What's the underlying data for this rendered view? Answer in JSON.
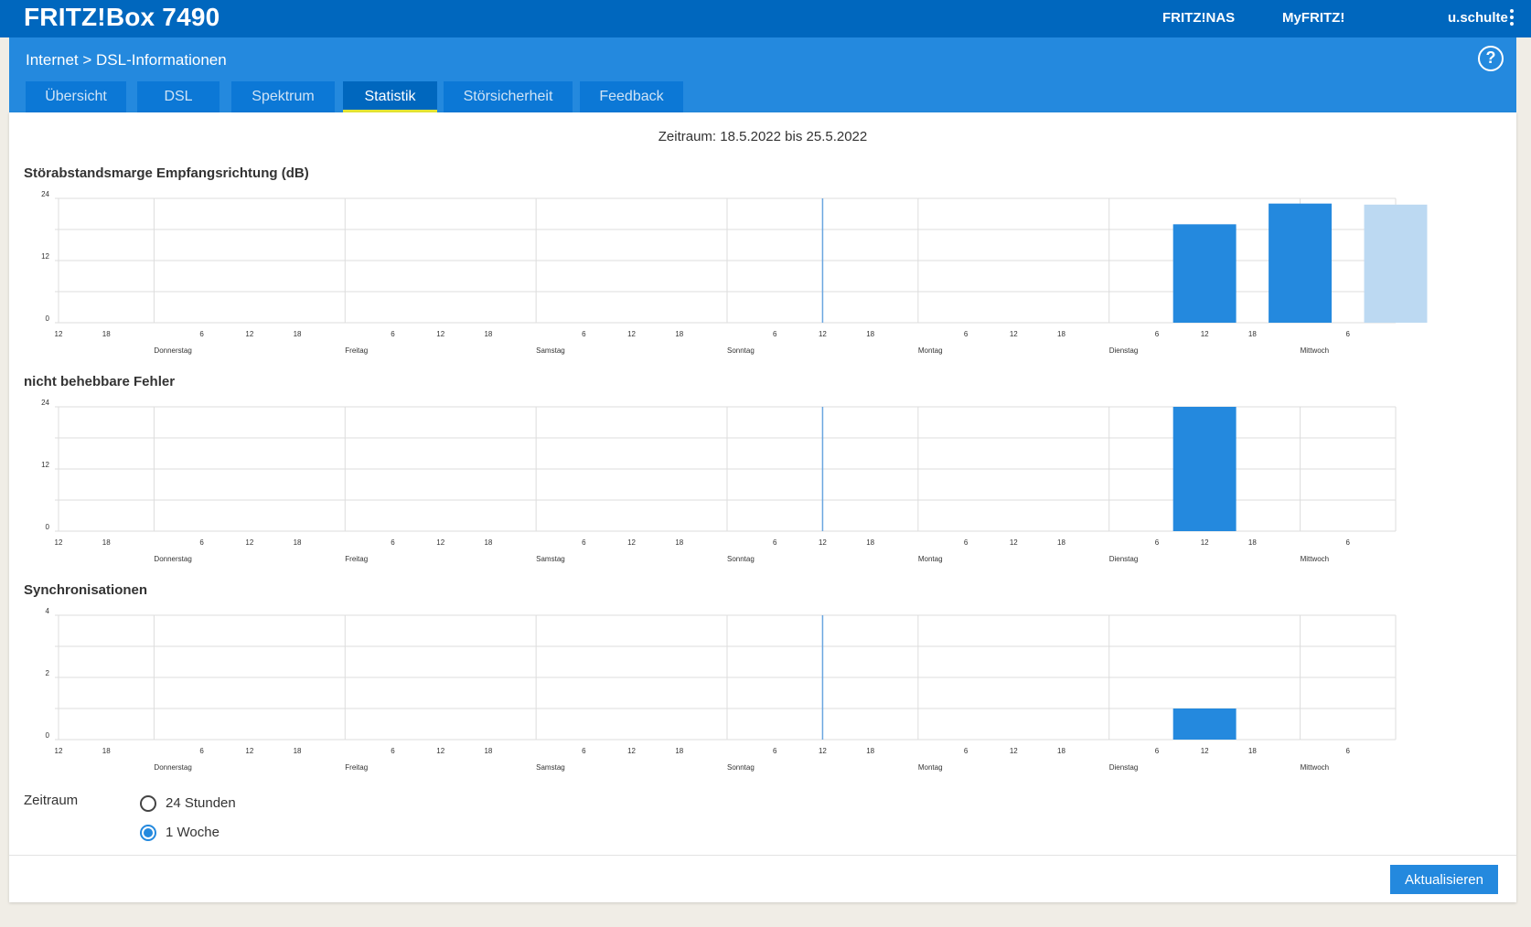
{
  "header": {
    "brand": "FRITZ!Box 7490",
    "links": [
      "FRITZ!NAS",
      "MyFRITZ!"
    ],
    "user": "u.schulte",
    "menu_icon": "kebab-menu-icon"
  },
  "subheader": {
    "breadcrumb": "Internet > DSL-Informationen",
    "help_icon": "help-icon",
    "help_symbol": "?"
  },
  "tabs": [
    {
      "label": "Übersicht",
      "active": false
    },
    {
      "label": "DSL",
      "active": false
    },
    {
      "label": "Spektrum",
      "active": false
    },
    {
      "label": "Statistik",
      "active": true
    },
    {
      "label": "Störsicherheit",
      "active": false
    },
    {
      "label": "Feedback",
      "active": false
    }
  ],
  "period_text": "Zeitraum: 18.5.2022 bis 25.5.2022",
  "colors": {
    "topbar": "#0067be",
    "subheader": "#2489de",
    "bar": "#2489de",
    "bar_light": "#bcd9f2",
    "marker": "#6aa6e0",
    "grid": "#dddddd"
  },
  "chart_data": [
    {
      "type": "bar",
      "title": "Störabstandsmarge Empfangsrichtung (dB)",
      "x_unit": "hour",
      "x_range": [
        12,
        180
      ],
      "bar_width_hours": 12,
      "ylim": [
        0,
        24
      ],
      "y_ticks": [
        0,
        12,
        24
      ],
      "grid": true,
      "day_labels": [
        "Donnerstag",
        "Freitag",
        "Samstag",
        "Sonntag",
        "Montag",
        "Dienstag",
        "Mittwoch"
      ],
      "hour_tick_labels": [
        "12",
        "18",
        "6",
        "12",
        "18",
        "6",
        "12",
        "18",
        "6",
        "12",
        "18",
        "6",
        "12",
        "18",
        "6",
        "12",
        "18",
        "6",
        "12",
        "18",
        "6"
      ],
      "current_marker_x": 108,
      "bars": [
        {
          "x": 150,
          "value": 19,
          "light": false
        },
        {
          "x": 162,
          "value": 23,
          "light": false
        },
        {
          "x": 174,
          "value": 22.8,
          "light": true
        }
      ]
    },
    {
      "type": "bar",
      "title": "nicht behebbare Fehler",
      "x_unit": "hour",
      "x_range": [
        12,
        180
      ],
      "bar_width_hours": 12,
      "ylim": [
        0,
        24
      ],
      "y_ticks": [
        0,
        12,
        24
      ],
      "grid": true,
      "day_labels": [
        "Donnerstag",
        "Freitag",
        "Samstag",
        "Sonntag",
        "Montag",
        "Dienstag",
        "Mittwoch"
      ],
      "hour_tick_labels": [
        "12",
        "18",
        "6",
        "12",
        "18",
        "6",
        "12",
        "18",
        "6",
        "12",
        "18",
        "6",
        "12",
        "18",
        "6",
        "12",
        "18",
        "6",
        "12",
        "18",
        "6"
      ],
      "current_marker_x": 108,
      "bars": [
        {
          "x": 150,
          "value": 24,
          "light": false
        }
      ]
    },
    {
      "type": "bar",
      "title": "Synchronisationen",
      "x_unit": "hour",
      "x_range": [
        12,
        180
      ],
      "bar_width_hours": 12,
      "ylim": [
        0,
        4
      ],
      "y_ticks": [
        0,
        2,
        4
      ],
      "grid": true,
      "day_labels": [
        "Donnerstag",
        "Freitag",
        "Samstag",
        "Sonntag",
        "Montag",
        "Dienstag",
        "Mittwoch"
      ],
      "hour_tick_labels": [
        "12",
        "18",
        "6",
        "12",
        "18",
        "6",
        "12",
        "18",
        "6",
        "12",
        "18",
        "6",
        "12",
        "18",
        "6",
        "12",
        "18",
        "6",
        "12",
        "18",
        "6"
      ],
      "current_marker_x": 108,
      "bars": [
        {
          "x": 150,
          "value": 1,
          "light": false
        }
      ]
    }
  ],
  "zeitraum": {
    "label": "Zeitraum",
    "options": [
      {
        "label": "24 Stunden",
        "checked": false
      },
      {
        "label": "1 Woche",
        "checked": true
      }
    ]
  },
  "actions": {
    "update_label": "Aktualisieren"
  }
}
